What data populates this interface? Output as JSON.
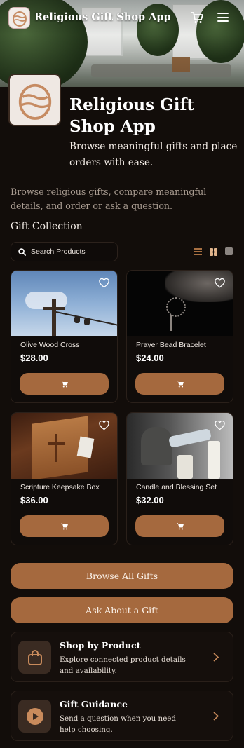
{
  "app": {
    "title": "Religious Gift Shop App",
    "logo_icon": "easter-egg-icon"
  },
  "header": {
    "cart_icon": "cart-icon",
    "menu_icon": "hamburger-menu-icon"
  },
  "intro": {
    "title": "Religious Gift Shop App",
    "subtitle": "Browse meaningful gifts and place orders with ease.",
    "description": "Browse religious gifts, compare meaningful details, and order or ask a question."
  },
  "collection": {
    "title": "Gift Collection",
    "search_placeholder": "Search Products",
    "view_modes": [
      "list-view-icon",
      "grid-view-icon",
      "large-view-icon"
    ]
  },
  "products": [
    {
      "name": "Olive Wood Cross",
      "price": "$28.00"
    },
    {
      "name": "Prayer Bead Bracelet",
      "price": "$24.00"
    },
    {
      "name": "Scripture Keepsake Box",
      "price": "$36.00"
    },
    {
      "name": "Candle and Blessing Set",
      "price": "$32.00"
    }
  ],
  "actions": {
    "browse_label": "Browse All Gifts",
    "ask_label": "Ask About a Gift"
  },
  "features": [
    {
      "title": "Shop by Product",
      "desc": "Explore connected product details and availability.",
      "icon": "shopping-bag-icon"
    },
    {
      "title": "Gift Guidance",
      "desc": "Send a question when you need help choosing.",
      "icon": "play-circle-icon"
    }
  ],
  "colors": {
    "background": "#120d0a",
    "accent": "#a5693e",
    "muted_text": "#a99c91"
  }
}
